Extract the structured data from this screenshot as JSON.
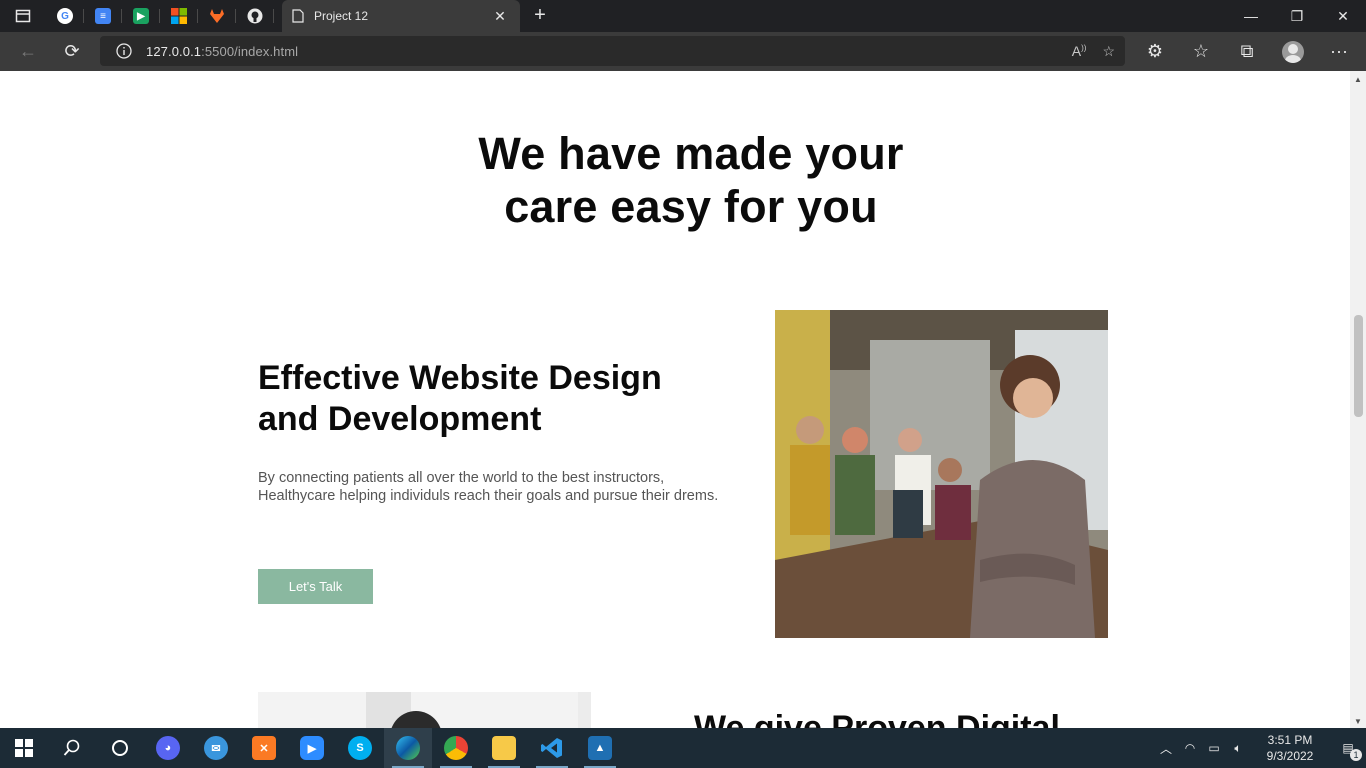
{
  "browser": {
    "active_tab_title": "Project 12",
    "url_host": "127.0.0.1",
    "url_rest": ":5500/index.html"
  },
  "page": {
    "hero_title": "We have made your care easy for you",
    "feature": {
      "title": "Effective Website Design and Development",
      "description": "By connecting patients all over the world to the best instructors, Healthycare helping individuls reach their goals and pursue their drems.",
      "button_label": "Let's Talk"
    },
    "next_section_title": "We give Proven Digital"
  },
  "taskbar": {
    "time": "3:51 PM",
    "date": "9/3/2022",
    "notification_count": "1"
  },
  "colors": {
    "button": "#8ab8a0",
    "page_bg": "#ffffff",
    "taskbar": "#1c2b36"
  }
}
